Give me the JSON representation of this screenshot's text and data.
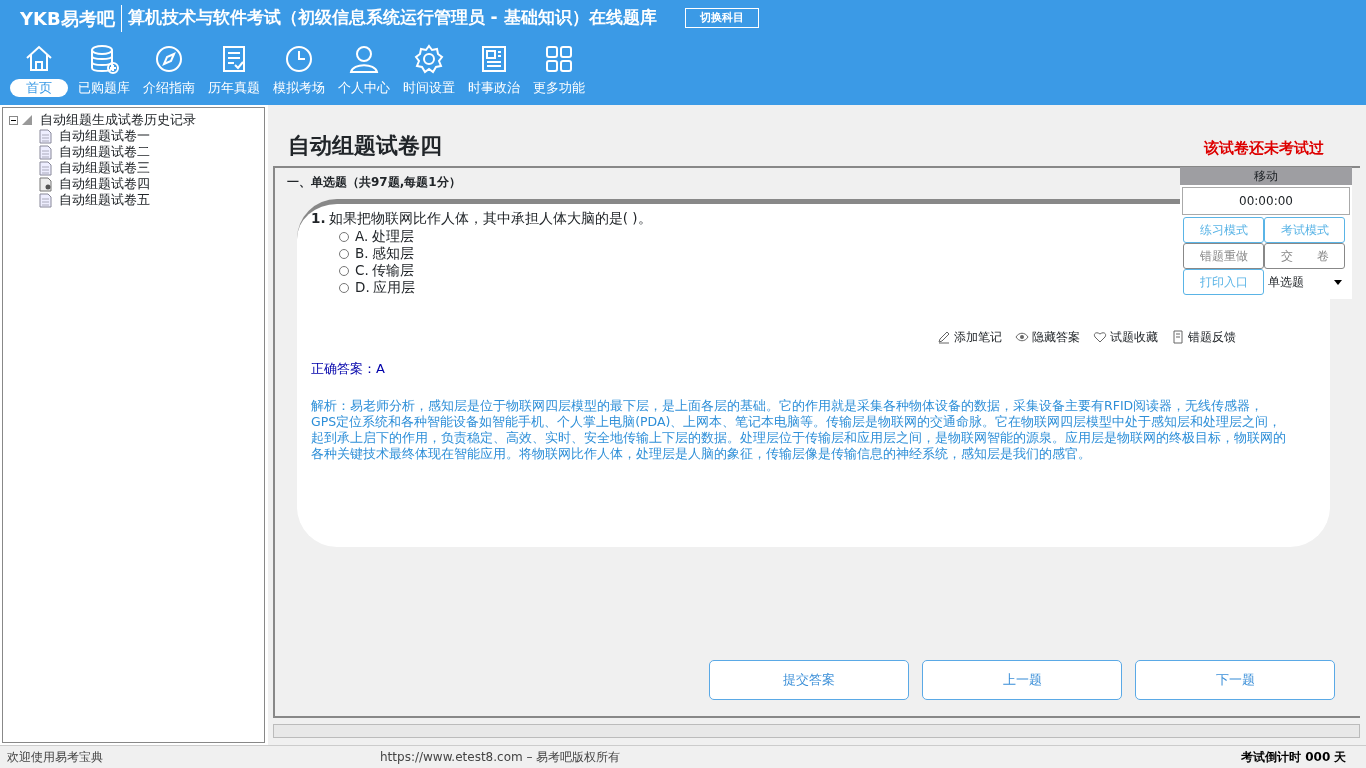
{
  "header": {
    "logo": "YKB易考吧",
    "title": "算机技术与软件考试（初级信息系统运行管理员 - 基础知识）在线题库",
    "switch_button": "切换科目"
  },
  "nav": [
    {
      "label": "首页",
      "selected": true
    },
    {
      "label": "已购题库",
      "selected": false
    },
    {
      "label": "介绍指南",
      "selected": false
    },
    {
      "label": "历年真题",
      "selected": false
    },
    {
      "label": "模拟考场",
      "selected": false
    },
    {
      "label": "个人中心",
      "selected": false
    },
    {
      "label": "时间设置",
      "selected": false
    },
    {
      "label": "时事政治",
      "selected": false
    },
    {
      "label": "更多功能",
      "selected": false
    }
  ],
  "tree": {
    "label": "自动组题生成试卷历史记录",
    "expanded": true,
    "children": [
      {
        "label": "自动组题试卷一",
        "kind": "doc"
      },
      {
        "label": "自动组题试卷二",
        "kind": "doc"
      },
      {
        "label": "自动组题试卷三",
        "kind": "doc"
      },
      {
        "label": "自动组题试卷四",
        "kind": "current"
      },
      {
        "label": "自动组题试卷五",
        "kind": "doc"
      }
    ]
  },
  "paper": {
    "title": "自动组题试卷四",
    "status": "该试卷还未考试过",
    "section": "一、单选题（共97题,每题1分）"
  },
  "question": {
    "number": "1.",
    "text": "如果把物联网比作人体，其中承担人体大脑的是(  )。",
    "options": [
      {
        "label": "A.",
        "text": "处理层",
        "selected": false
      },
      {
        "label": "B.",
        "text": "感知层",
        "selected": false
      },
      {
        "label": "C.",
        "text": "传输层",
        "selected": false
      },
      {
        "label": "D.",
        "text": "应用层",
        "selected": false
      }
    ]
  },
  "actions": [
    "添加笔记",
    "隐藏答案",
    "试题收藏",
    "错题反馈"
  ],
  "answer": {
    "label": "正确答案：",
    "value": "A"
  },
  "analysis": "解析：易老师分析，感知层是位于物联网四层模型的最下层，是上面各层的基础。它的作用就是采集各种物体设备的数据，采集设备主要有RFID阅读器，无线传感器，GPS定位系统和各种智能设备如智能手机、个人掌上电脑(PDA)、上网本、笔记本电脑等。传输层是物联网的交通命脉。它在物联网四层模型中处于感知层和处理层之间，起到承上启下的作用，负责稳定、高效、实时、安全地传输上下层的数据。处理层位于传输层和应用层之间，是物联网智能的源泉。应用层是物联网的终极目标，物联网的各种关键技术最终体现在智能应用。将物联网比作人体，处理层是人脑的象征，传输层像是传输信息的神经系统，感知层是我们的感官。",
  "nav_buttons": [
    "提交答案",
    "上一题",
    "下一题"
  ],
  "side_panel": {
    "move_label": "移动",
    "timer": "00:00:00",
    "buttons": [
      {
        "label": "练习模式",
        "kind": "primary"
      },
      {
        "label": "考试模式",
        "kind": "primary"
      },
      {
        "label": "错题重做",
        "kind": "secondary"
      },
      {
        "label": "交　　卷",
        "kind": "secondary"
      },
      {
        "label": "打印入口",
        "kind": "primary"
      }
    ],
    "type_select": "单选题"
  },
  "status_bar": {
    "welcome": "欢迎使用易考宝典",
    "copyright": "https://www.etest8.com – 易考吧版权所有",
    "countdown": "考试倒计时 000 天"
  }
}
